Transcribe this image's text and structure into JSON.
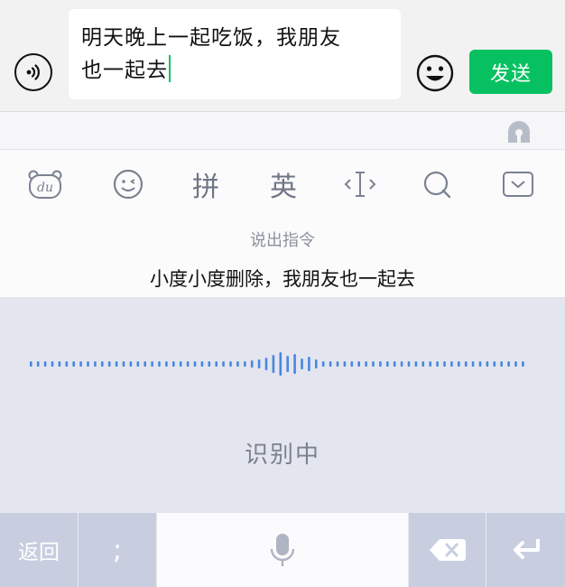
{
  "chat": {
    "text_line1": "明天晚上一起吃饭，我朋友",
    "text_line2": "也一起去",
    "send_label": "发送"
  },
  "toolbar": {
    "pinyin": "拼",
    "english": "英"
  },
  "voice": {
    "hint_label": "说出指令",
    "command_example": "小度小度删除，我朋友也一起去",
    "status": "识别中"
  },
  "keys": {
    "back": "返回",
    "semicolon": ";"
  },
  "colors": {
    "accent": "#07c160",
    "wave": "#4a86e0"
  },
  "icons": [
    "voice-toggle-icon",
    "emoji-icon",
    "keyboard-logo-icon",
    "du-bear-icon",
    "smile-icon",
    "cursor-icon",
    "search-icon",
    "collapse-icon",
    "microphone-icon",
    "delete-icon",
    "enter-icon"
  ]
}
